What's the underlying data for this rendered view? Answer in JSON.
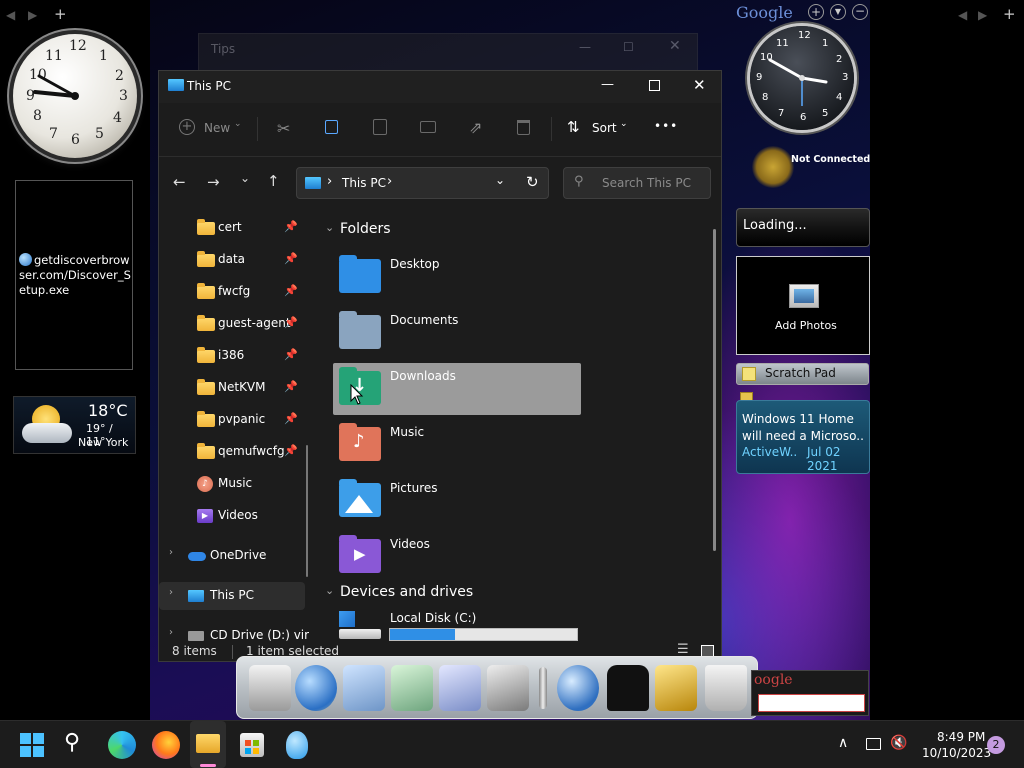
{
  "left_gadgets": {
    "nav_prev": "◀",
    "nav_next": "▶",
    "nav_add": "+",
    "clock_numbers": [
      "12",
      "1",
      "2",
      "3",
      "4",
      "5",
      "6",
      "7",
      "8",
      "9",
      "10",
      "11"
    ],
    "desktop_link_text": "getdiscoverbrowser.com/Discover_Setup.exe",
    "weather": {
      "temp": "18°C",
      "range": "19° / 11°",
      "city": "New York"
    }
  },
  "right_gadgets": {
    "google_label": "Google",
    "clock_numbers": [
      "12",
      "1",
      "2",
      "3",
      "4",
      "5",
      "6",
      "7",
      "8",
      "9",
      "10",
      "11"
    ],
    "network_status": "Not Connected",
    "loading_text": "Loading...",
    "photos_label": "Add Photos",
    "scratch_pad_label": "Scratch Pad",
    "news": {
      "headline": "Windows 11 Home will need a Microso..",
      "source": "ActiveW..",
      "date": "Jul 02 2021"
    },
    "nav_prev": "◀",
    "nav_next": "▶",
    "nav_add": "+",
    "google_search_label": "oogle"
  },
  "tips_window": {
    "title": "Tips"
  },
  "explorer": {
    "title": "This PC",
    "toolbar": {
      "new_label": "New",
      "sort_label": "Sort",
      "more_label": "•••"
    },
    "address": {
      "location": "This PC",
      "separator": "›"
    },
    "search": {
      "placeholder": "Search This PC"
    },
    "nav_pane": {
      "quick_access": [
        {
          "label": "cert"
        },
        {
          "label": "data"
        },
        {
          "label": "fwcfg"
        },
        {
          "label": "guest-agent"
        },
        {
          "label": "i386"
        },
        {
          "label": "NetKVM"
        },
        {
          "label": "pvpanic"
        },
        {
          "label": "qemufwcfg"
        }
      ],
      "music_label": "Music",
      "videos_label": "Videos",
      "onedrive_label": "OneDrive",
      "thispc_label": "This PC",
      "cddrive_label": "CD Drive (D:) virt"
    },
    "sections": {
      "folders": "Folders",
      "devices": "Devices and drives"
    },
    "folders": [
      {
        "label": "Desktop",
        "color": "#2f8fe6"
      },
      {
        "label": "Documents",
        "color": "#8aa4bf"
      },
      {
        "label": "Downloads",
        "color": "#25a377"
      },
      {
        "label": "Music",
        "color": "#e0745a"
      },
      {
        "label": "Pictures",
        "color": "#3d9ee9"
      },
      {
        "label": "Videos",
        "color": "#8a58d6"
      }
    ],
    "drive": {
      "label": "Local Disk (C:)",
      "usage": 0.35
    },
    "status": {
      "items": "8 items",
      "selected": "1 item selected"
    }
  },
  "taskbar": {
    "time": "8:49 PM",
    "date": "10/10/2023",
    "notification_count": "2",
    "up_arrow": "∧"
  }
}
